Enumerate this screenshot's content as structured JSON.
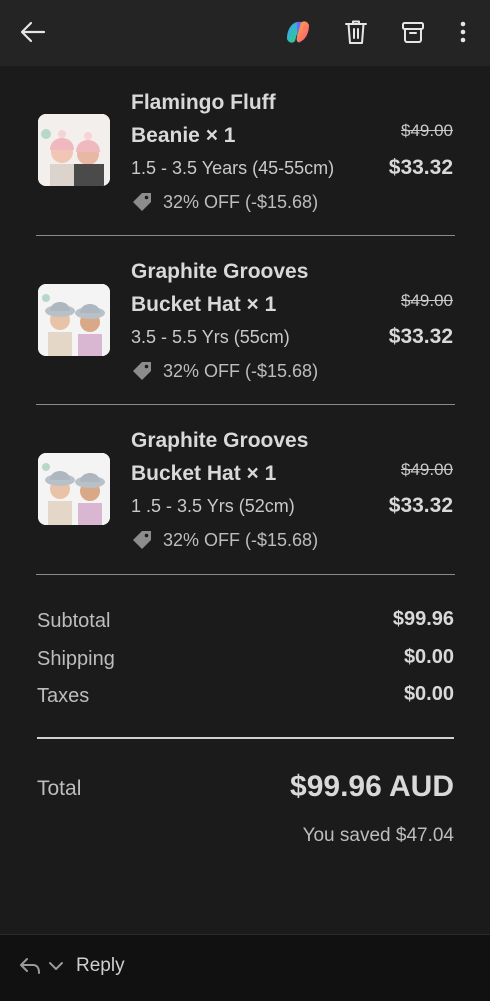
{
  "toolbar": {
    "back_icon": "arrow-left-icon",
    "copilot_icon": "copilot-icon",
    "delete_icon": "trash-icon",
    "archive_icon": "archive-icon",
    "more_icon": "more-vertical-icon"
  },
  "items": [
    {
      "name_line1": "Flamingo Fluff",
      "name_line2": "Beanie × 1",
      "variant": "1.5 - 3.5 Years (45-55cm)",
      "discount": "32% OFF (-$15.68)",
      "original_price": "$49.00",
      "price": "$33.32"
    },
    {
      "name_line1": "Graphite Grooves",
      "name_line2": "Bucket Hat × 1",
      "variant": "3.5 - 5.5 Yrs (55cm)",
      "discount": "32% OFF (-$15.68)",
      "original_price": "$49.00",
      "price": "$33.32"
    },
    {
      "name_line1": "Graphite Grooves",
      "name_line2": "Bucket Hat × 1",
      "variant": "1 .5 - 3.5 Yrs (52cm)",
      "discount": "32% OFF (-$15.68)",
      "original_price": "$49.00",
      "price": "$33.32"
    }
  ],
  "summary": {
    "subtotal_label": "Subtotal",
    "subtotal_value": "$99.96",
    "shipping_label": "Shipping",
    "shipping_value": "$0.00",
    "taxes_label": "Taxes",
    "taxes_value": "$0.00",
    "total_label": "Total",
    "total_value": "$99.96 AUD",
    "saved_text": "You saved $47.04"
  },
  "bottom": {
    "reply_label": "Reply"
  },
  "colors": {
    "background": "#1b1b1b",
    "topbar": "#242424",
    "bottombar": "#111111"
  }
}
